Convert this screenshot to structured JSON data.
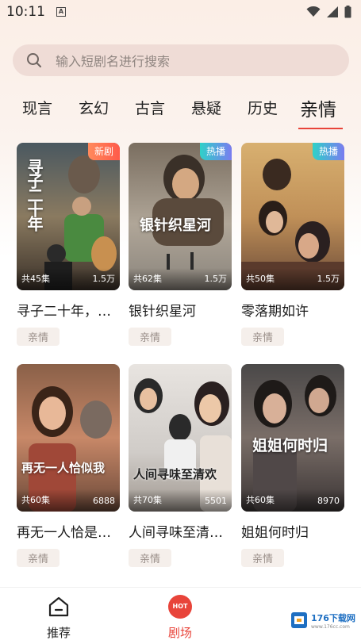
{
  "status_bar": {
    "time": "10:11",
    "notification_icon": "a-letter-icon",
    "icons": [
      "wifi-icon",
      "signal-icon",
      "battery-icon"
    ]
  },
  "search": {
    "placeholder": "输入短剧名进行搜索"
  },
  "tabs": [
    {
      "label": "现言",
      "active": false
    },
    {
      "label": "玄幻",
      "active": false
    },
    {
      "label": "古言",
      "active": false
    },
    {
      "label": "悬疑",
      "active": false
    },
    {
      "label": "历史",
      "active": false
    },
    {
      "label": "亲情",
      "active": true
    }
  ],
  "dramas": [
    {
      "title": "寻子二十年，…",
      "poster_text": "寻子二十年",
      "badge": "新剧",
      "episodes": "共45集",
      "views": "1.5万",
      "genre": "亲情"
    },
    {
      "title": "银针织星河",
      "poster_text": "银针织星河",
      "badge": "热播",
      "episodes": "共62集",
      "views": "1.5万",
      "genre": "亲情"
    },
    {
      "title": "零落期如许",
      "poster_text": "",
      "badge": "热播",
      "episodes": "共50集",
      "views": "1.5万",
      "genre": "亲情"
    },
    {
      "title": "再无一人恰是…",
      "poster_text": "再无一人恰似我",
      "badge": "",
      "episodes": "共60集",
      "views": "6888",
      "genre": "亲情"
    },
    {
      "title": "人间寻味至清…",
      "poster_text": "人间寻味至清欢",
      "badge": "",
      "episodes": "共70集",
      "views": "5501",
      "genre": "亲情"
    },
    {
      "title": "姐姐何时归",
      "poster_text": "姐姐何时归",
      "badge": "",
      "episodes": "共60集",
      "views": "8970",
      "genre": "亲情"
    }
  ],
  "bottom_nav": [
    {
      "label": "推荐",
      "icon": "home-icon",
      "active": false
    },
    {
      "label": "剧场",
      "icon": "hot-icon",
      "icon_text": "HOT",
      "active": true
    }
  ],
  "watermark": {
    "text": "176下载网",
    "sub": "www.176cc.com"
  },
  "colors": {
    "accent": "#e8443a",
    "search_bg": "#efdcd6",
    "tag_bg": "#f5efeb",
    "badge_new": "#ff6a4f",
    "badge_hot": "#5aa8e0"
  }
}
